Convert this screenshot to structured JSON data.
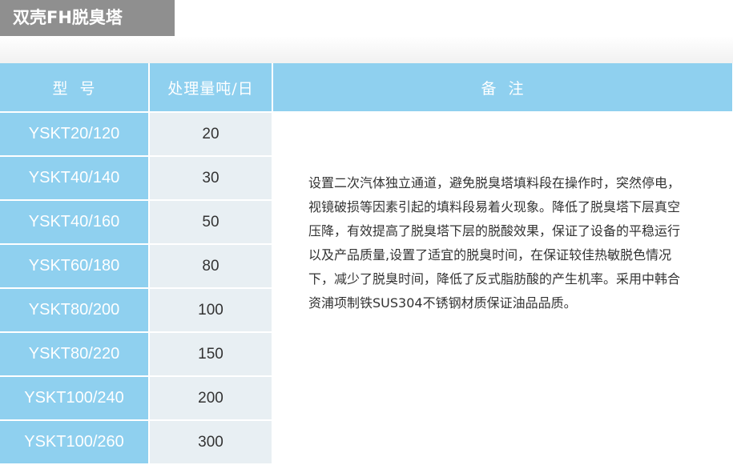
{
  "title": "双壳FH脱臭塔",
  "table": {
    "headers": [
      "型  号",
      "处理量吨/日",
      "备  注"
    ],
    "rows": [
      {
        "model": "YSKT20/120",
        "capacity": "20"
      },
      {
        "model": "YSKT40/140",
        "capacity": "30"
      },
      {
        "model": "YSKT40/160",
        "capacity": "50"
      },
      {
        "model": "YSKT60/180",
        "capacity": "80"
      },
      {
        "model": "YSKT80/200",
        "capacity": "100"
      },
      {
        "model": "YSKT80/220",
        "capacity": "150"
      },
      {
        "model": "YSKT100/240",
        "capacity": "200"
      },
      {
        "model": "YSKT100/260",
        "capacity": "300"
      }
    ],
    "remark": "设置二次汽体独立通道，避免脱臭塔填料段在操作时，突然停电，视镜破损等因素引起的填料段易着火现象。降低了脱臭塔下层真空压降，有效提高了脱臭塔下层的脱酸效果，保证了设备的平稳运行以及产品质量,设置了适宜的脱臭时间，在保证较佳热敏脱色情况下，减少了脱臭时间，降低了反式脂肪酸的产生机率。采用中韩合资浦项制铁SUS304不锈钢材质保证油品品质。"
  },
  "colors": {
    "title_bg": "#8f8f8f",
    "header_bg": "#8fd0ef",
    "capacity_bg": "#e8eff3",
    "text": "#333333"
  }
}
